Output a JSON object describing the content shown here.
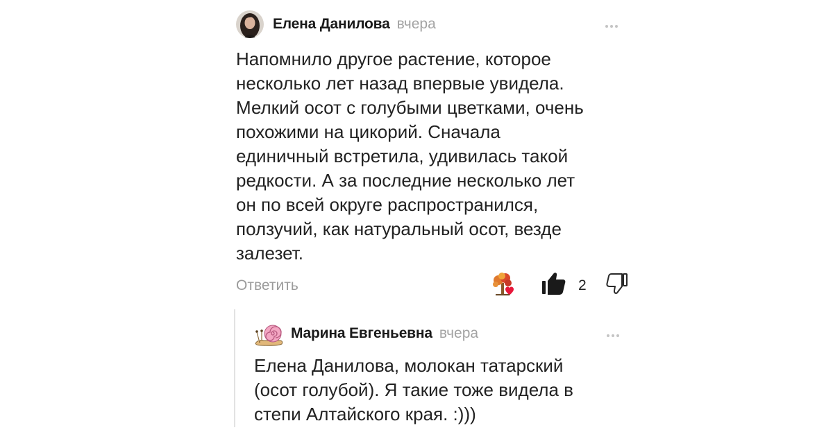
{
  "comment": {
    "author": "Елена Данилова",
    "date": "вчера",
    "text": "Напомнило другое растение, которое\nнесколько лет назад впервые увидела.\nМелкий осот с голубыми цветками, очень\nпохожими на цикорий. Сначала\nединичный встретила, удивилась такой\nредкости. А за последние несколько лет\nон по всей округе распространился,\nползучий, как натуральный осот, везде\nзалезет.",
    "reply_label": "Ответить",
    "like_count": "2",
    "icons": {
      "more": "more-dots-icon",
      "reaction": "tree-heart-icon",
      "like": "thumbs-up-icon",
      "dislike": "thumbs-down-icon"
    }
  },
  "reply": {
    "author": "Марина Евгеньевна",
    "date": "вчера",
    "text": "Елена Данилова, молокан татарский\n(осот голубой). Я такие тоже видела в\nстепи Алтайского края. :)))",
    "icons": {
      "avatar": "snail-avatar",
      "more": "more-dots-icon"
    }
  },
  "colors": {
    "text": "#222222",
    "muted": "#9b9b9b",
    "thread_line": "#e2e2e2"
  }
}
